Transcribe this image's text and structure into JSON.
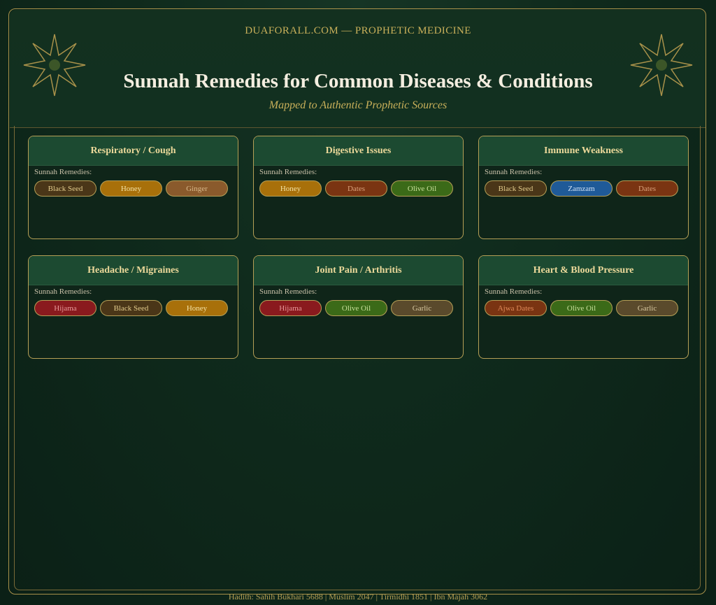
{
  "header": {
    "site": "DUAFORALL.COM — PROPHETIC MEDICINE",
    "title": "Sunnah Remedies for Common Diseases & Conditions",
    "subtitle": "Mapped to Authentic Prophetic Sources"
  },
  "remedies_label": "Sunnah Remedies:",
  "cards": [
    {
      "title": "Respiratory / Cough",
      "remedies": [
        {
          "name": "Black Seed",
          "bg": "#4a3618",
          "fg": "#e0c98a"
        },
        {
          "name": "Honey",
          "bg": "#a8700a",
          "fg": "#f4e3a6"
        },
        {
          "name": "Ginger",
          "bg": "#8a5a2c",
          "fg": "#d8b88a"
        }
      ]
    },
    {
      "title": "Digestive Issues",
      "remedies": [
        {
          "name": "Honey",
          "bg": "#a8700a",
          "fg": "#f4e3a6"
        },
        {
          "name": "Dates",
          "bg": "#7a3412",
          "fg": "#d9a07a"
        },
        {
          "name": "Olive Oil",
          "bg": "#3b6a18",
          "fg": "#c8e09a"
        }
      ]
    },
    {
      "title": "Immune Weakness",
      "remedies": [
        {
          "name": "Black Seed",
          "bg": "#4a3618",
          "fg": "#e0c98a"
        },
        {
          "name": "Zamzam",
          "bg": "#1f5a98",
          "fg": "#cfe0f4"
        },
        {
          "name": "Dates",
          "bg": "#7a3412",
          "fg": "#d9a07a"
        }
      ]
    },
    {
      "title": "Headache / Migraines",
      "remedies": [
        {
          "name": "Hijama",
          "bg": "#8a1a1e",
          "fg": "#e89a9a"
        },
        {
          "name": "Black Seed",
          "bg": "#4a3618",
          "fg": "#e0c98a"
        },
        {
          "name": "Honey",
          "bg": "#a8700a",
          "fg": "#f4e3a6"
        }
      ]
    },
    {
      "title": "Joint Pain / Arthritis",
      "remedies": [
        {
          "name": "Hijama",
          "bg": "#8a1a1e",
          "fg": "#e89a9a"
        },
        {
          "name": "Olive Oil",
          "bg": "#3b6a18",
          "fg": "#c8e09a"
        },
        {
          "name": "Garlic",
          "bg": "#5a4a2c",
          "fg": "#d8c8a0"
        }
      ]
    },
    {
      "title": "Heart & Blood Pressure",
      "remedies": [
        {
          "name": "Ajwa Dates",
          "bg": "#7a3412",
          "fg": "#e08a5a"
        },
        {
          "name": "Olive Oil",
          "bg": "#3b6a18",
          "fg": "#c8e09a"
        },
        {
          "name": "Garlic",
          "bg": "#5a4a2c",
          "fg": "#d8c8a0"
        }
      ]
    }
  ],
  "footer": "Hadith: Sahih Bukhari 5688  |  Muslim 2047  |  Tirmidhi 1851  |  Ibn Majah 3062"
}
